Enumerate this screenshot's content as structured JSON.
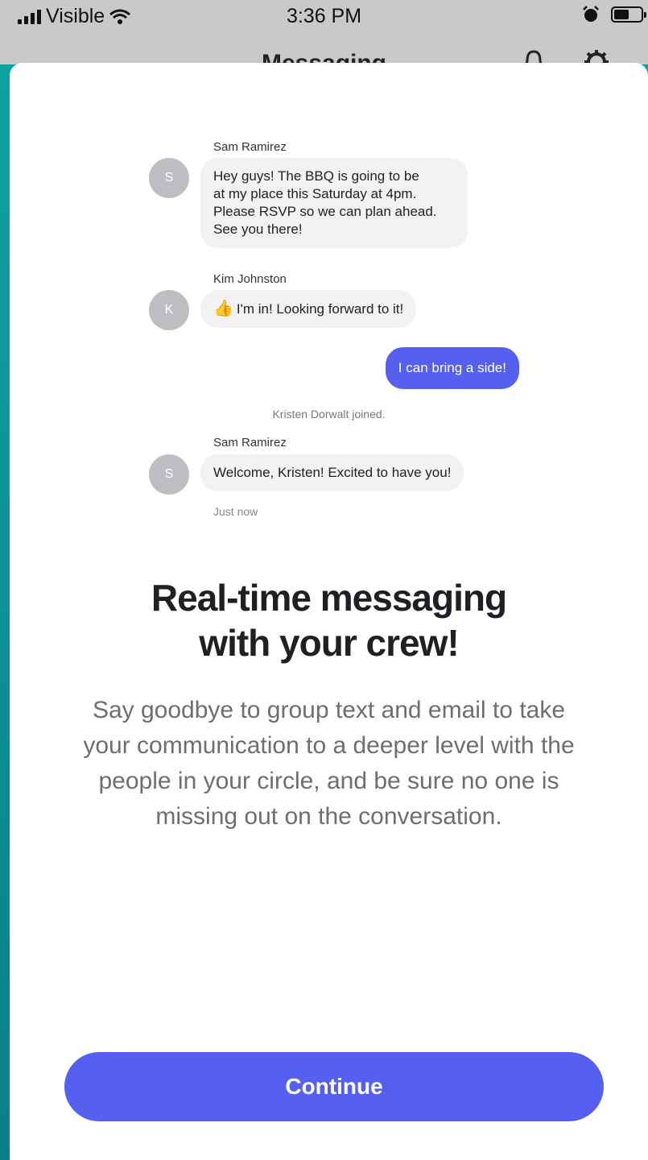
{
  "status_bar": {
    "carrier": "Visible",
    "time": "3:36 PM"
  },
  "nav": {
    "title": "Messaging"
  },
  "messages": [
    {
      "sender": "Sam Ramirez",
      "initial": "S",
      "text_lines": [
        "Hey guys! The BBQ is going to be",
        "at my place this Saturday at 4pm.",
        "Please RSVP so we can plan ahead.",
        "See you there!"
      ]
    },
    {
      "sender": "Kim Johnston",
      "initial": "K",
      "text": "I'm in! Looking forward to it!"
    },
    {
      "mine": true,
      "text": "I can bring a side!"
    },
    {
      "system": "Kristen Dorwalt joined."
    },
    {
      "sender": "Sam Ramirez",
      "initial": "S",
      "text": "Welcome, Kristen! Excited to have you!",
      "timestamp": "Just now"
    }
  ],
  "headline_lines": [
    "Real-time messaging",
    "with your crew!"
  ],
  "description_lines": [
    "Say goodbye to group text and email to take",
    "your communication to a deeper level with the",
    "people in your circle, and be sure no one is",
    "missing out on the conversation."
  ],
  "continue_label": "Continue",
  "colors": {
    "accent": "#5560f0",
    "bubble": "#f2f2f4",
    "side_gradient": "#0fa3a3"
  }
}
